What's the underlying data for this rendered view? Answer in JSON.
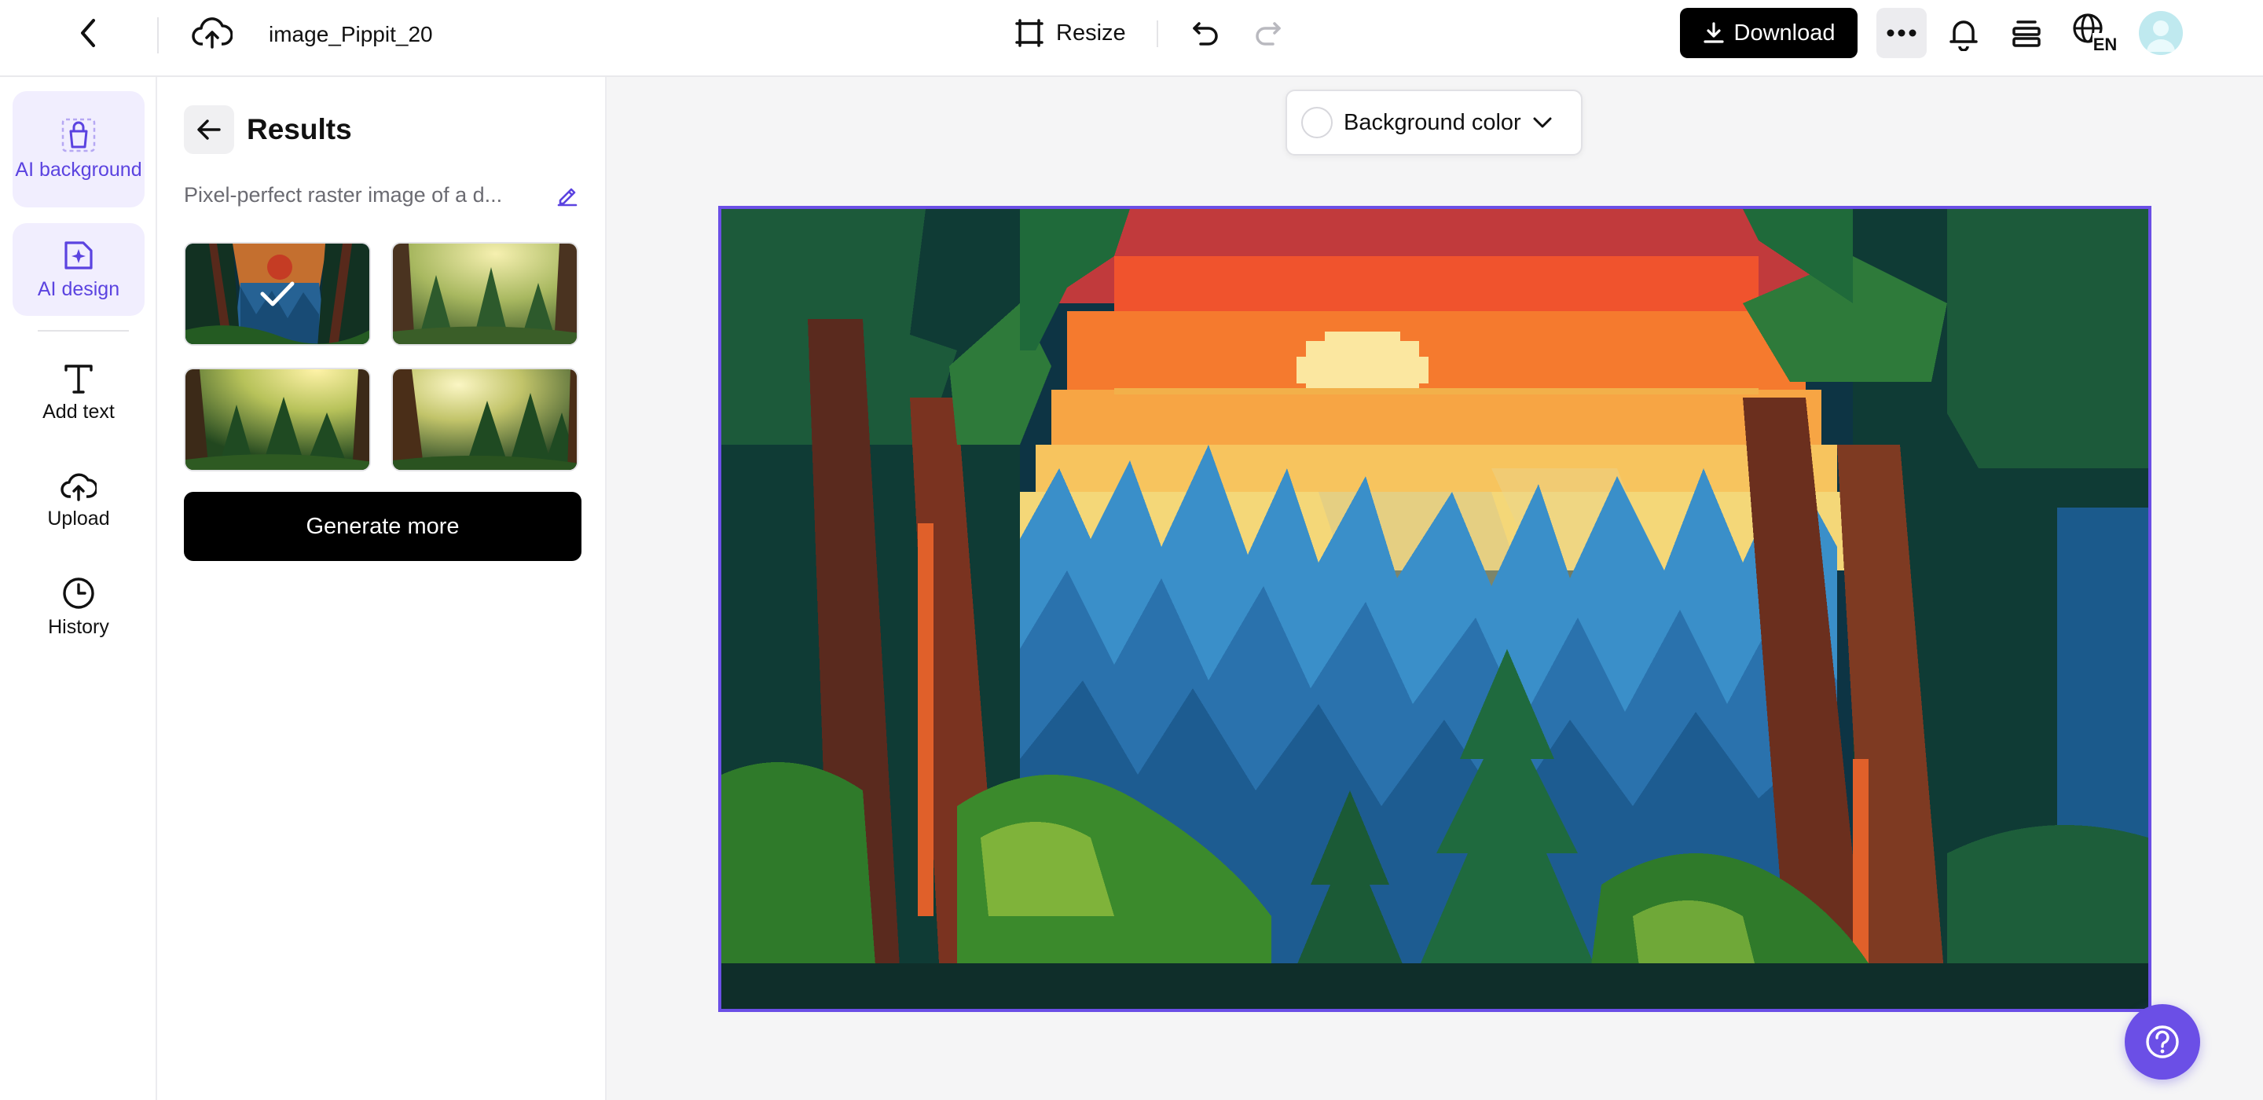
{
  "topbar": {
    "file_name": "image_Pippit_20",
    "resize_label": "Resize",
    "download_label": "Download",
    "language_code": "EN"
  },
  "rail": {
    "items": [
      {
        "label": "AI background",
        "icon": "bag-icon",
        "active": true
      },
      {
        "label": "AI design",
        "icon": "sparkle-image-icon",
        "active": true
      },
      {
        "label": "Add text",
        "icon": "text-icon",
        "active": false
      },
      {
        "label": "Upload",
        "icon": "upload-cloud-icon",
        "active": false
      },
      {
        "label": "History",
        "icon": "clock-icon",
        "active": false
      }
    ]
  },
  "panel": {
    "title": "Results",
    "prompt": "Pixel-perfect raster image of a d...",
    "generate_label": "Generate more",
    "thumbnails": [
      {
        "name": "result-1",
        "selected": true
      },
      {
        "name": "result-2",
        "selected": false
      },
      {
        "name": "result-3",
        "selected": false
      },
      {
        "name": "result-4",
        "selected": false
      }
    ]
  },
  "canvas": {
    "background_color_label": "Background color"
  },
  "colors": {
    "accent": "#6b4fe6",
    "accent_soft": "#f1eefe",
    "primary_button": "#000000"
  }
}
